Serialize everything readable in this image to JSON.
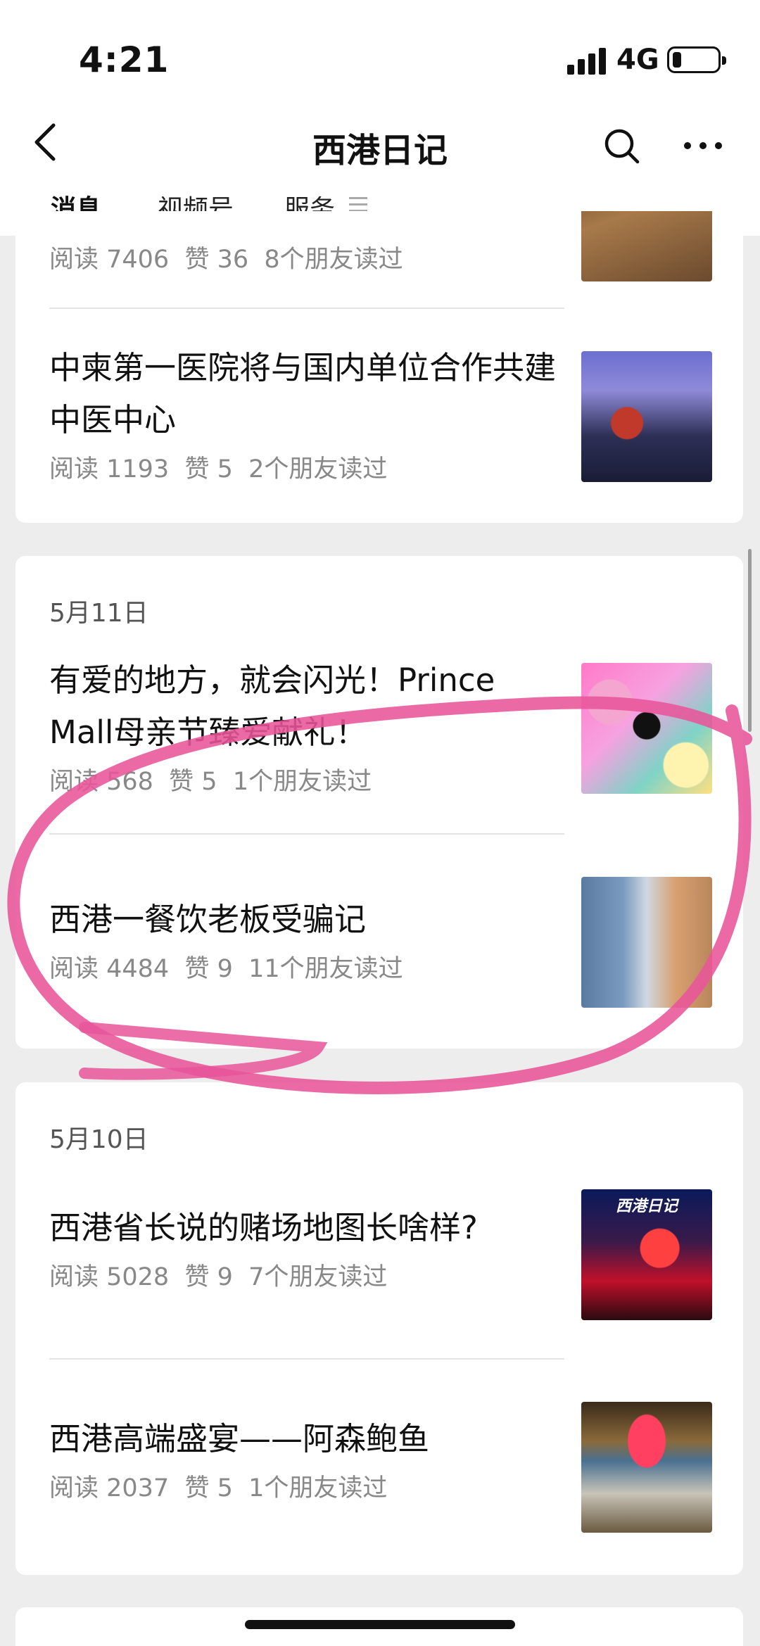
{
  "status_bar": {
    "time": "4:21",
    "network": "4G"
  },
  "nav": {
    "title": "西港日记",
    "tabs": [
      {
        "label": "消息",
        "active": true
      },
      {
        "label": "视频号",
        "active": false
      },
      {
        "label": "服务",
        "active": false
      }
    ]
  },
  "feed": {
    "card1": {
      "articles": [
        {
          "title": "",
          "meta": "阅读 7406  赞 36  8个朋友读过",
          "thumb": "food-photo"
        },
        {
          "title": "中柬第一医院将与国内单位合作共建中医中心",
          "meta": "阅读 1193  赞 5  2个朋友读过",
          "thumb": "signing-ceremony-photo"
        }
      ]
    },
    "card2": {
      "date": "5月11日",
      "articles": [
        {
          "title": "有爱的地方，就会闪光！Prince Mall母亲节臻爱献礼！",
          "meta": "阅读 568  赞 5  1个朋友读过",
          "thumb": "mothers-day-poster"
        },
        {
          "title": "西港一餐饮老板受骗记",
          "meta": "阅读 4484  赞 9  11个朋友读过",
          "thumb": "two-people-photo"
        }
      ]
    },
    "card3": {
      "date": "5月10日",
      "articles": [
        {
          "title": "西港省长说的赌场地图长啥样?",
          "meta": "阅读 5028  赞 9  7个朋友读过",
          "thumb": "casino-photo",
          "thumb_label": "西港日记"
        },
        {
          "title": "西港高端盛宴——阿森鲍鱼",
          "meta": "阅读 2037  赞 5  1个朋友读过",
          "thumb": "banquet-hall-photo"
        }
      ]
    }
  },
  "colors": {
    "annotation_stroke": "#e8559a",
    "background": "#ededed"
  }
}
